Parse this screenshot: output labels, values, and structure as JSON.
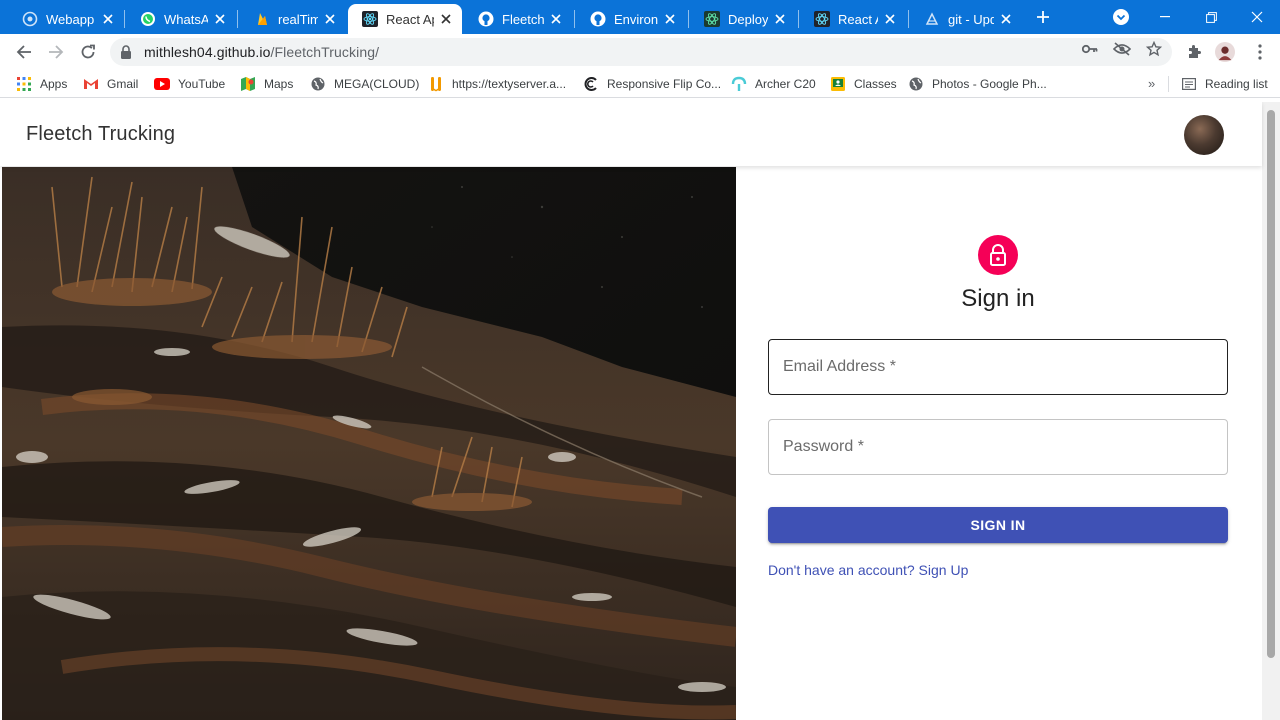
{
  "browser": {
    "tabs": [
      {
        "label": "Webapp",
        "icon": "webapp-favicon",
        "active": false
      },
      {
        "label": "WhatsApp",
        "icon": "whatsapp-favicon",
        "active": false
      },
      {
        "label": "realTime",
        "icon": "flame-favicon",
        "active": false
      },
      {
        "label": "React App",
        "icon": "react-favicon",
        "active": true
      },
      {
        "label": "FleetchTrucking",
        "icon": "github-favicon",
        "active": false
      },
      {
        "label": "Environment",
        "icon": "github-favicon",
        "active": false
      },
      {
        "label": "Deployment",
        "icon": "react-favicon",
        "active": false
      },
      {
        "label": "React App",
        "icon": "react-favicon",
        "active": false
      },
      {
        "label": "git - Update",
        "icon": "git-favicon",
        "active": false
      }
    ],
    "url_host": "mithlesh04.github.io",
    "url_path": "/FleetchTrucking/",
    "bookmarks": [
      {
        "label": "Apps",
        "icon": "apps-grid-icon"
      },
      {
        "label": "Gmail",
        "icon": "gmail-icon"
      },
      {
        "label": "YouTube",
        "icon": "youtube-icon"
      },
      {
        "label": "Maps",
        "icon": "maps-icon"
      },
      {
        "label": "MEGA(CLOUD)",
        "icon": "globe-icon"
      },
      {
        "label": "https://textyserver.a...",
        "icon": "textyserver-icon"
      },
      {
        "label": "Responsive Flip Co...",
        "icon": "flip-icon"
      },
      {
        "label": "Archer C20",
        "icon": "archer-icon"
      },
      {
        "label": "Classes",
        "icon": "classes-icon"
      },
      {
        "label": "Photos - Google Ph...",
        "icon": "globe-icon"
      }
    ],
    "reading_list": "Reading list",
    "more_bookmarks": "»"
  },
  "app": {
    "brand": "Fleetch Trucking",
    "signin_title": "Sign in",
    "email_placeholder": "Email Address *",
    "password_placeholder": "Password *",
    "signin_button": "SIGN IN",
    "signup_link": "Don't have an account? Sign Up"
  },
  "colors": {
    "tabstrip": "#0b73d8",
    "primary": "#3f51b5",
    "secondary": "#f50057"
  }
}
